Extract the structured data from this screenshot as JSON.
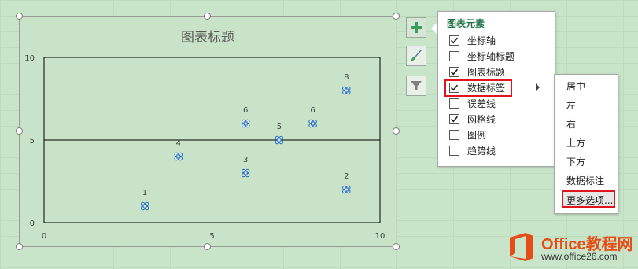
{
  "chart": {
    "title": "图表标题"
  },
  "chart_data": {
    "type": "scatter",
    "title": "图表标题",
    "xlabel": "",
    "ylabel": "",
    "xlim": [
      0,
      10
    ],
    "ylim": [
      0,
      10
    ],
    "x_ticks": [
      0,
      5,
      10
    ],
    "y_ticks": [
      0,
      5,
      10
    ],
    "grid": true,
    "points": [
      {
        "x": 3,
        "y": 1,
        "label": "1"
      },
      {
        "x": 4,
        "y": 4,
        "label": "4"
      },
      {
        "x": 6,
        "y": 3,
        "label": "3"
      },
      {
        "x": 6,
        "y": 6,
        "label": "6"
      },
      {
        "x": 7,
        "y": 5,
        "label": "5"
      },
      {
        "x": 8,
        "y": 6,
        "label": "6"
      },
      {
        "x": 9,
        "y": 2,
        "label": "2"
      },
      {
        "x": 9,
        "y": 8,
        "label": "8"
      }
    ],
    "marker_color": "#2e75b6"
  },
  "side_buttons": {
    "elements_icon": "plus-icon",
    "styles_icon": "brush-icon",
    "filters_icon": "filter-icon"
  },
  "elements_panel": {
    "title": "图表元素",
    "items": [
      {
        "label": "坐标轴",
        "checked": true
      },
      {
        "label": "坐标轴标题",
        "checked": false
      },
      {
        "label": "图表标题",
        "checked": true
      },
      {
        "label": "数据标签",
        "checked": true
      },
      {
        "label": "误差线",
        "checked": false
      },
      {
        "label": "网格线",
        "checked": true
      },
      {
        "label": "图例",
        "checked": false
      },
      {
        "label": "趋势线",
        "checked": false
      }
    ]
  },
  "label_submenu": {
    "items": [
      "居中",
      "左",
      "右",
      "上方",
      "下方",
      "数据标注"
    ],
    "more": "更多选项..."
  },
  "colors": {
    "accent_green": "#217346",
    "highlight_red": "#e0161e",
    "watermark_orange": "#e64c15"
  },
  "watermark": {
    "name": "Office教程网",
    "url": "www.office26.com"
  }
}
